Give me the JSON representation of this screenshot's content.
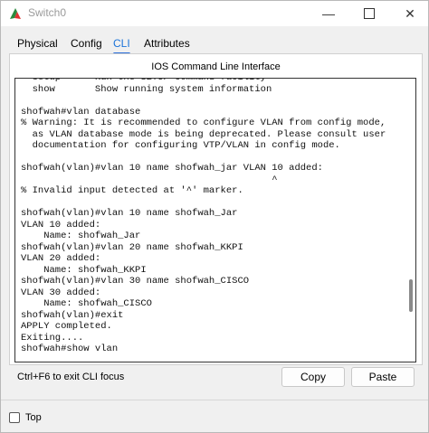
{
  "window": {
    "title": "Switch0",
    "minimize_glyph": "—",
    "close_glyph": "✕"
  },
  "tabs": [
    {
      "label": "Physical",
      "active": false
    },
    {
      "label": "Config",
      "active": false
    },
    {
      "label": "CLI",
      "active": true
    },
    {
      "label": "Attributes",
      "active": false
    }
  ],
  "cli": {
    "heading": "IOS Command Line Interface",
    "output": "  setup      Run the SETUP command facility\n  show       Show running system information\n\nshofwah#vlan database\n% Warning: It is recommended to configure VLAN from config mode,\n  as VLAN database mode is being deprecated. Please consult user\n  documentation for configuring VTP/VLAN in config mode.\n\nshofwah(vlan)#vlan 10 name shofwah_jar VLAN 10 added:\n                                            ^\n% Invalid input detected at '^' marker.\n\nshofwah(vlan)#vlan 10 name shofwah_Jar\nVLAN 10 added:\n    Name: shofwah_Jar\nshofwah(vlan)#vlan 20 name shofwah_KKPI\nVLAN 20 added:\n    Name: shofwah_KKPI\nshofwah(vlan)#vlan 30 name shofwah_CISCO\nVLAN 30 added:\n    Name: shofwah_CISCO\nshofwah(vlan)#exit\nAPPLY completed.\nExiting....\nshofwah#show vlan"
  },
  "footer": {
    "hint": "Ctrl+F6 to exit CLI focus",
    "copy_label": "Copy",
    "paste_label": "Paste"
  },
  "bottom": {
    "top_label": "Top",
    "top_checked": false
  },
  "colors": {
    "accent": "#2a6fdb",
    "background": "#f0f0f0"
  }
}
